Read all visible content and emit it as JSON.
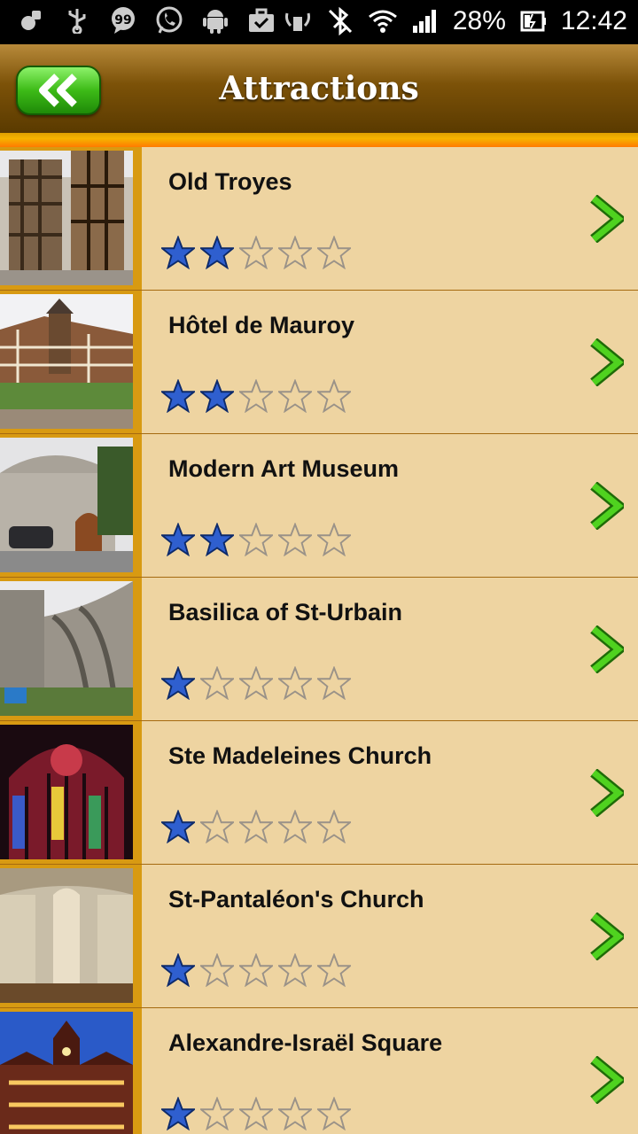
{
  "status_bar": {
    "battery": "28%",
    "time": "12:42",
    "icons": [
      "notification-icon",
      "usb-icon",
      "chat-icon",
      "whatsapp-icon",
      "android-icon",
      "briefcase-icon",
      "signal-tower-icon",
      "bluetooth-icon",
      "wifi-icon",
      "cell-signal-icon",
      "battery-icon"
    ]
  },
  "header": {
    "title": "Attractions",
    "back_icon": "double-chevron-left-icon"
  },
  "colors": {
    "row_bg": "#eed4a1",
    "thumb_border": "#d89a12",
    "star_fill": "#2f5fcf",
    "chevron": "#3cb818"
  },
  "attractions": [
    {
      "name": "Old Troyes",
      "rating": 2
    },
    {
      "name": "Hôtel de Mauroy",
      "rating": 2
    },
    {
      "name": "Modern Art Museum",
      "rating": 2
    },
    {
      "name": "Basilica of St-Urbain",
      "rating": 1
    },
    {
      "name": "Ste Madeleines Church",
      "rating": 1
    },
    {
      "name": "St-Pantaléon's Church",
      "rating": 1
    },
    {
      "name": "Alexandre-Israël Square",
      "rating": 1
    }
  ]
}
